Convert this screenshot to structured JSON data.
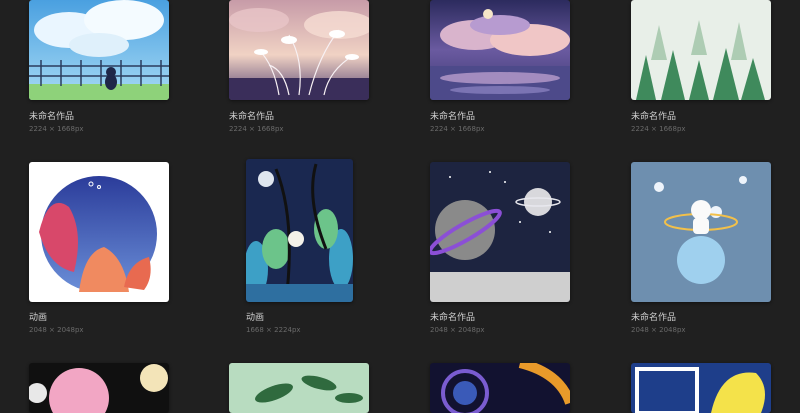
{
  "gallery": {
    "row1": [
      {
        "title": "未命名作品",
        "dims": "2224 × 1668px",
        "art": "cat-fence-sky-artwork"
      },
      {
        "title": "未命名作品",
        "dims": "2224 × 1668px",
        "art": "reeds-sunset-artwork"
      },
      {
        "title": "未命名作品",
        "dims": "2224 × 1668px",
        "art": "cloud-sea-reflection-artwork"
      },
      {
        "title": "未命名作品",
        "dims": "2224 × 1668px",
        "art": "misty-forest-artwork"
      }
    ],
    "row2": [
      {
        "title": "动画",
        "dims": "2048 × 2048px",
        "art": "circle-plants-artwork"
      },
      {
        "title": "动画",
        "dims": "1668 × 2224px",
        "art": "jungle-night-artwork"
      },
      {
        "title": "未命名作品",
        "dims": "2048 × 2048px",
        "art": "planets-space-artwork"
      },
      {
        "title": "未命名作品",
        "dims": "2048 × 2048px",
        "art": "astronaut-planet-artwork"
      }
    ],
    "row3": [
      {
        "art": "pink-planet-artwork"
      },
      {
        "art": "green-leaves-artwork"
      },
      {
        "art": "galaxy-swirl-artwork"
      },
      {
        "art": "abstract-blue-yellow-artwork"
      }
    ]
  }
}
